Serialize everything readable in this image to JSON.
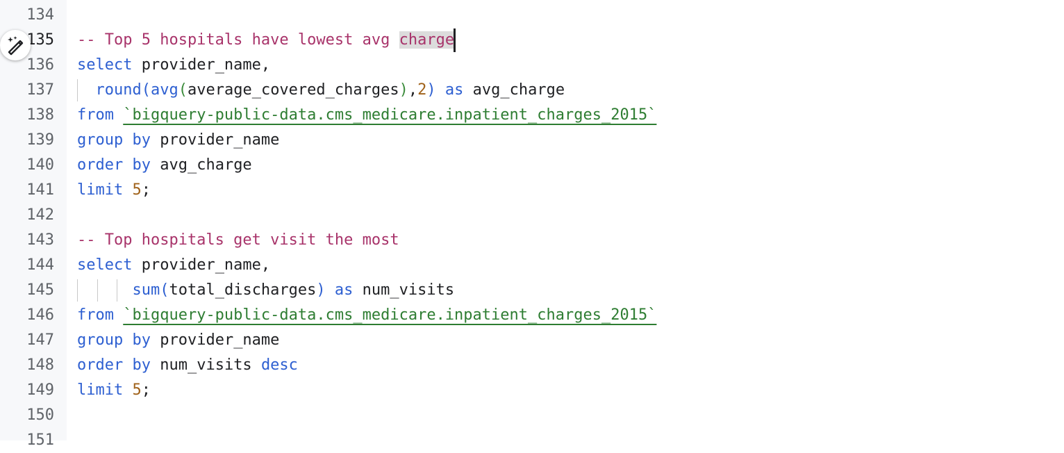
{
  "editor": {
    "line_numbers": [
      "134",
      "135",
      "136",
      "137",
      "138",
      "139",
      "140",
      "141",
      "142",
      "143",
      "144",
      "145",
      "146",
      "147",
      "148",
      "149",
      "150",
      "151"
    ],
    "lines": [
      {
        "segments": []
      },
      {
        "segments": [
          {
            "text": "-- Top 5 hospitals have lowest avg ",
            "type": "comment"
          },
          {
            "text": "charge",
            "type": "comment-selected"
          }
        ]
      },
      {
        "segments": [
          {
            "text": "select",
            "type": "keyword"
          },
          {
            "text": " provider_name,",
            "type": "plain"
          }
        ]
      },
      {
        "segments": [
          {
            "text": "  ",
            "type": "plain"
          },
          {
            "text": "round",
            "type": "function"
          },
          {
            "text": "(",
            "type": "paren-blue"
          },
          {
            "text": "avg",
            "type": "function"
          },
          {
            "text": "(",
            "type": "paren-green"
          },
          {
            "text": "average_covered_charges",
            "type": "plain"
          },
          {
            "text": ")",
            "type": "paren-green"
          },
          {
            "text": ",",
            "type": "plain"
          },
          {
            "text": "2",
            "type": "number"
          },
          {
            "text": ")",
            "type": "paren-blue"
          },
          {
            "text": " ",
            "type": "plain"
          },
          {
            "text": "as",
            "type": "keyword"
          },
          {
            "text": " avg_charge",
            "type": "plain"
          }
        ]
      },
      {
        "segments": [
          {
            "text": "from",
            "type": "keyword"
          },
          {
            "text": " ",
            "type": "plain"
          },
          {
            "text": "`bigquery-public-data.cms_medicare.inpatient_charges_2015`",
            "type": "string"
          }
        ]
      },
      {
        "segments": [
          {
            "text": "group",
            "type": "keyword"
          },
          {
            "text": " ",
            "type": "plain"
          },
          {
            "text": "by",
            "type": "keyword"
          },
          {
            "text": " provider_name",
            "type": "plain"
          }
        ]
      },
      {
        "segments": [
          {
            "text": "order",
            "type": "keyword"
          },
          {
            "text": " ",
            "type": "plain"
          },
          {
            "text": "by",
            "type": "keyword"
          },
          {
            "text": " avg_charge",
            "type": "plain"
          }
        ]
      },
      {
        "segments": [
          {
            "text": "limit",
            "type": "keyword"
          },
          {
            "text": " ",
            "type": "plain"
          },
          {
            "text": "5",
            "type": "number"
          },
          {
            "text": ";",
            "type": "plain"
          }
        ]
      },
      {
        "segments": []
      },
      {
        "segments": [
          {
            "text": "-- Top hospitals get visit the most",
            "type": "comment"
          }
        ]
      },
      {
        "segments": [
          {
            "text": "select",
            "type": "keyword"
          },
          {
            "text": " provider_name,",
            "type": "plain"
          }
        ]
      },
      {
        "segments": [
          {
            "text": "      ",
            "type": "plain"
          },
          {
            "text": "sum",
            "type": "function"
          },
          {
            "text": "(",
            "type": "paren-blue"
          },
          {
            "text": "total_discharges",
            "type": "plain"
          },
          {
            "text": ")",
            "type": "paren-blue"
          },
          {
            "text": " ",
            "type": "plain"
          },
          {
            "text": "as",
            "type": "keyword"
          },
          {
            "text": " num_visits",
            "type": "plain"
          }
        ]
      },
      {
        "segments": [
          {
            "text": "from",
            "type": "keyword"
          },
          {
            "text": " ",
            "type": "plain"
          },
          {
            "text": "`bigquery-public-data.cms_medicare.inpatient_charges_2015`",
            "type": "string"
          }
        ]
      },
      {
        "segments": [
          {
            "text": "group",
            "type": "keyword"
          },
          {
            "text": " ",
            "type": "plain"
          },
          {
            "text": "by",
            "type": "keyword"
          },
          {
            "text": " provider_name",
            "type": "plain"
          }
        ]
      },
      {
        "segments": [
          {
            "text": "order",
            "type": "keyword"
          },
          {
            "text": " ",
            "type": "plain"
          },
          {
            "text": "by",
            "type": "keyword"
          },
          {
            "text": " num_visits ",
            "type": "plain"
          },
          {
            "text": "desc",
            "type": "keyword"
          }
        ]
      },
      {
        "segments": [
          {
            "text": "limit",
            "type": "keyword"
          },
          {
            "text": " ",
            "type": "plain"
          },
          {
            "text": "5",
            "type": "number"
          },
          {
            "text": ";",
            "type": "plain"
          }
        ]
      },
      {
        "segments": []
      },
      {
        "segments": []
      }
    ],
    "active_line_index": 1,
    "ai_button_icon": "magic-pen-icon"
  }
}
